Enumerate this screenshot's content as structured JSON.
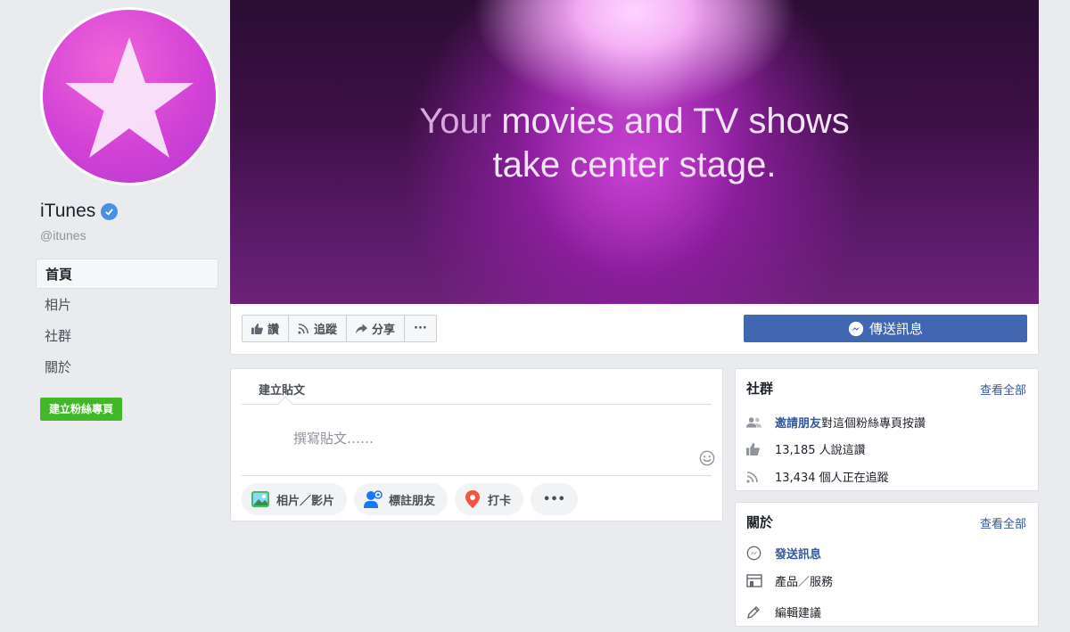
{
  "page": {
    "name": "iTunes",
    "handle": "@itunes"
  },
  "nav": {
    "items": [
      {
        "label": "首頁"
      },
      {
        "label": "相片"
      },
      {
        "label": "社群"
      },
      {
        "label": "關於"
      }
    ],
    "create_page_label": "建立粉絲專頁"
  },
  "cover": {
    "line1_part1": "Your",
    "line1_part2": " movies and TV shows",
    "line2": "take center stage."
  },
  "actions": {
    "like": "讚",
    "follow": "追蹤",
    "share": "分享",
    "more": "···",
    "send_message": "傳送訊息"
  },
  "composer": {
    "tab_label": "建立貼文",
    "placeholder": "撰寫貼文……",
    "chips": {
      "photo": "相片／影片",
      "tag": "標註朋友",
      "checkin": "打卡",
      "more": "•••"
    }
  },
  "community": {
    "title": "社群",
    "see_all": "查看全部",
    "invite_link": "邀請朋友",
    "invite_text": " 對這個粉絲專頁按讚",
    "likes_text": "13,185 人說這讚",
    "follows_text": "13,434 個人正在追蹤"
  },
  "about": {
    "title": "關於",
    "see_all": "查看全部",
    "send_message": "發送訊息",
    "products": "產品／服務",
    "suggest_edits": "編輯建議"
  },
  "colors": {
    "brand_blue": "#4267b2",
    "link_blue": "#365899",
    "create_green": "#42b72a",
    "verified_blue": "#4a90e2",
    "avatar_pink": "#d243d6"
  }
}
